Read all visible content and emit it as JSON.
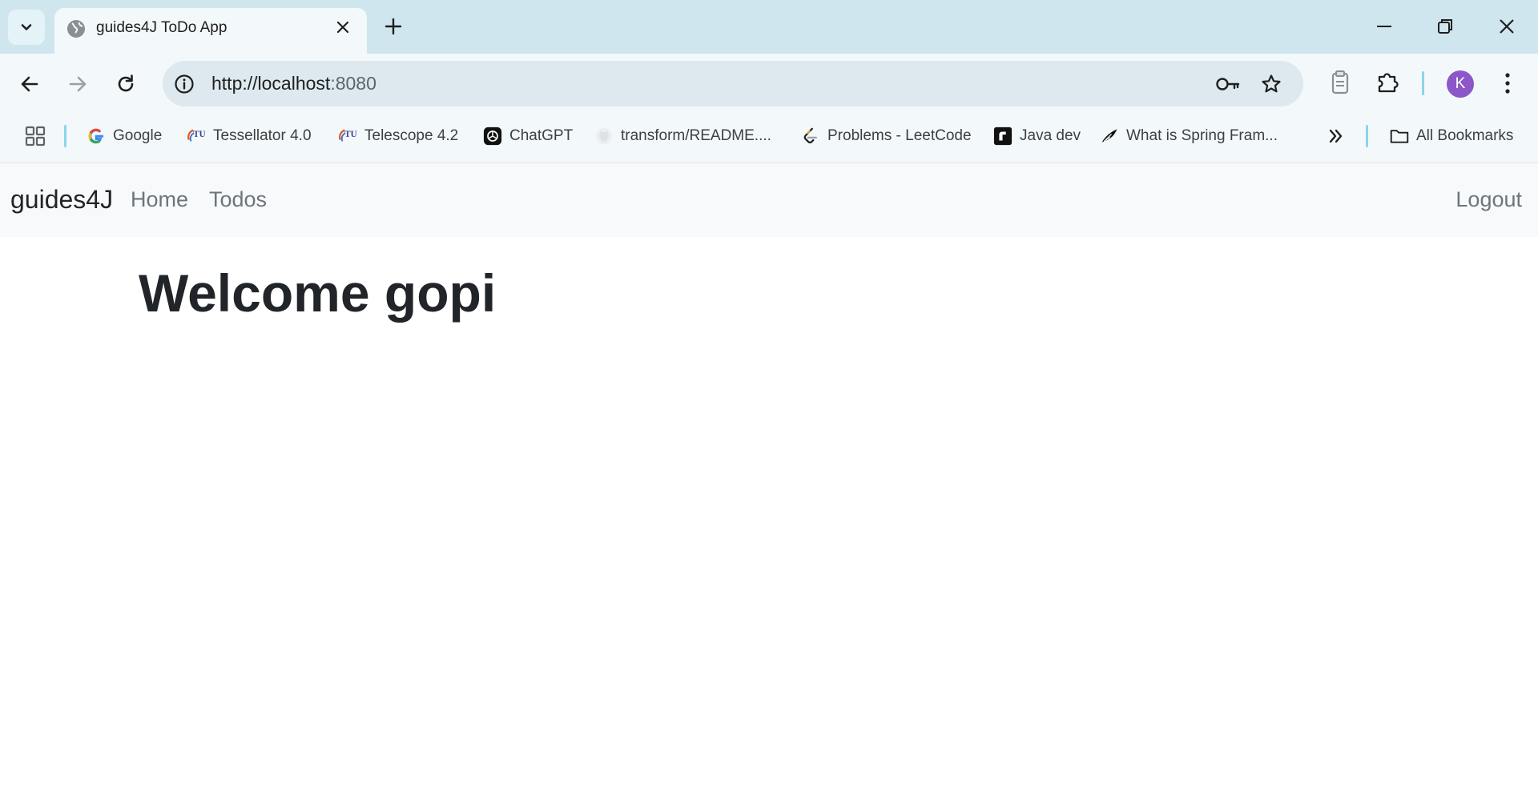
{
  "browser": {
    "tab_title": "guides4J ToDo App",
    "url_host": "http://localhost",
    "url_port": ":8080",
    "profile_initial": "K"
  },
  "bookmarks": {
    "items": [
      {
        "label": "Google",
        "icon": "google-icon"
      },
      {
        "label": "Tessellator 4.0",
        "icon": "tu-logo-icon"
      },
      {
        "label": "Telescope 4.2",
        "icon": "tu-logo-icon"
      },
      {
        "label": "ChatGPT",
        "icon": "chatgpt-icon"
      },
      {
        "label": "transform/README....",
        "icon": "github-icon"
      },
      {
        "label": "Problems - LeetCode",
        "icon": "leetcode-icon"
      },
      {
        "label": "Java dev",
        "icon": "replit-icon"
      },
      {
        "label": "What is Spring Fram...",
        "icon": "spring-feather-icon"
      }
    ],
    "all_bookmarks_label": "All Bookmarks"
  },
  "app": {
    "brand": "guides4J",
    "nav": [
      "Home",
      "Todos"
    ],
    "logout": "Logout",
    "welcome": "Welcome gopi"
  },
  "colors": {
    "tabstrip_bg": "#cfe6ee",
    "toolbar_bg": "#f3f8fa",
    "avatar": "#8d56c9",
    "navbar_bg": "#f8f9fa"
  }
}
